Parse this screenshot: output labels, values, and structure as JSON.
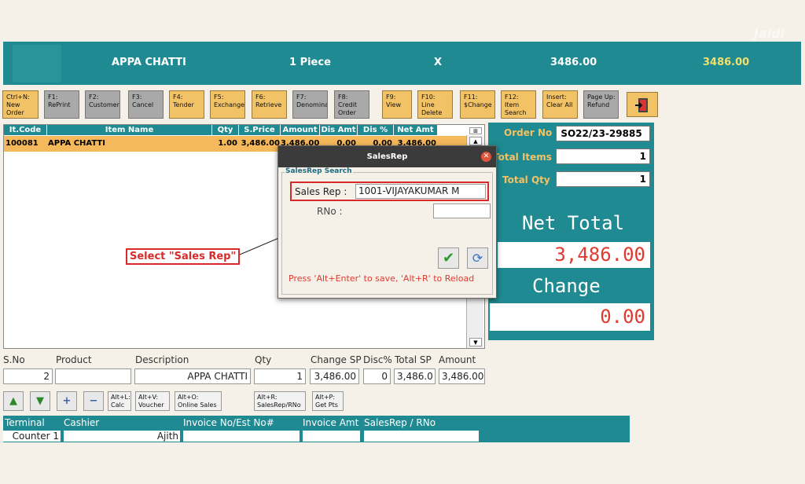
{
  "header": {
    "item_name": "APPA CHATTI",
    "pieces": "1 Piece",
    "multiplier": "X",
    "amount": "3486.00",
    "total": "3486.00",
    "watermark": "Jaldi"
  },
  "toolbar": {
    "keys": [
      {
        "label": "Ctrl+N:\nNew\nOrder",
        "style": "orange"
      },
      {
        "label": "F1:\nRePrint",
        "style": "grey"
      },
      {
        "label": "F2:\nCustomer",
        "style": "grey"
      },
      {
        "label": "F3:\nCancel",
        "style": "grey"
      },
      {
        "label": "F4:\nTender",
        "style": "orange"
      },
      {
        "label": "F5:\nExchange",
        "style": "orange"
      },
      {
        "label": "F6:\nRetrieve",
        "style": "orange"
      },
      {
        "label": "F7:\nDenomina",
        "style": "grey"
      },
      {
        "label": "F8:\nCredit\nOrder",
        "style": "grey"
      },
      {
        "label": "F9:\nView",
        "style": "orange"
      },
      {
        "label": "F10:\nLine\nDelete",
        "style": "orange"
      },
      {
        "label": "F11:\n$Change",
        "style": "orange"
      },
      {
        "label": "F12:\nItem\nSearch",
        "style": "orange"
      },
      {
        "label": "Insert:\nClear All",
        "style": "orange"
      },
      {
        "label": "Page Up:\nRefund",
        "style": "grey"
      }
    ],
    "exit_icon": "exit-door-icon"
  },
  "grid": {
    "columns": [
      "It.Code",
      "Item Name",
      "Qty",
      "S.Price",
      "Amount",
      "Dis Amt",
      "Dis %",
      "Net Amt"
    ],
    "rows": [
      [
        "100081",
        "APPA CHATTI",
        "1.00",
        "3,486.00",
        "3,486.00",
        "0.00",
        "0.00",
        "3,486.00"
      ]
    ]
  },
  "summary": {
    "order_no_label": "Order No",
    "order_no": "SO22/23-29885",
    "total_items_label": "Total Items",
    "total_items": "1",
    "total_qty_label": "Total Qty",
    "total_qty": "1",
    "net_total_label": "Net Total",
    "net_total": "3,486.00",
    "change_label": "Change",
    "change": "0.00"
  },
  "entry": {
    "labels": [
      "S.No",
      "Product",
      "Description",
      "Qty",
      "Change SP",
      "Disc%",
      "Total SP",
      "Amount"
    ],
    "sno": "2",
    "product": "",
    "description": "APPA CHATTI",
    "qty": "1",
    "change_sp": "3,486.00",
    "disc": "0",
    "total_sp": "3,486.0",
    "amount": "3,486.00"
  },
  "actions": {
    "calc": "Alt+L:\nCalc",
    "voucher": "Alt+V:\nVoucher",
    "online": "Alt+O:\nOnline Sales",
    "salesrep": "Alt+R:\nSalesRep/RNo",
    "getpts": "Alt+P:\nGet Pts"
  },
  "footer": {
    "terminal_label": "Terminal",
    "terminal": "Counter 1",
    "cashier_label": "Cashier",
    "cashier": "Ajith",
    "invoice_label": "Invoice No/Est No#",
    "invoice": "",
    "invoice_amt_label": "Invoice Amt",
    "invoice_amt": "",
    "salesrep_label": "SalesRep / RNo",
    "salesrep": ""
  },
  "dialog": {
    "title": "SalesRep",
    "group": "SalesRep Search",
    "sales_rep_label": "Sales Rep :",
    "sales_rep_value": "1001-VIJAYAKUMAR M",
    "rno_label": "RNo :",
    "rno_value": "",
    "note": "Press 'Alt+Enter' to save, 'Alt+R' to Reload"
  },
  "callout": "Select \"Sales Rep\""
}
